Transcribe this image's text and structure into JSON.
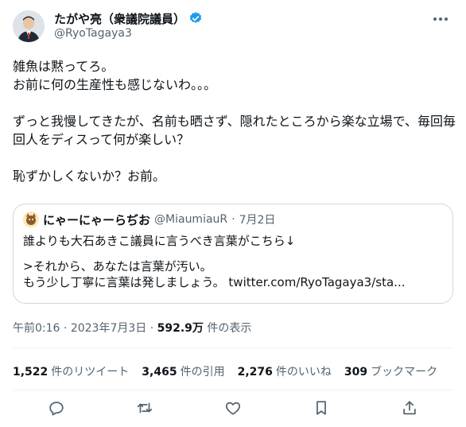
{
  "author": {
    "display_name": "たがや亮（衆議院議員）",
    "handle": "@RyoTagaya3"
  },
  "tweet": {
    "lines": [
      "雑魚は黙ってろ。",
      "お前に何の生産性も感じないわ。。。",
      "ずっと我慢してきたが、名前も晒さず、隠れたところから楽な立場で、毎回毎回人をディスって何が楽しい？",
      "恥ずかしくないか？お前。"
    ]
  },
  "quote": {
    "display_name": "にゃーにゃーらぢお",
    "handle": "@MiaumiauR",
    "separator": "·",
    "date": "7月2日",
    "line1": "誰よりも大石あきこ議員に言うべき言葉がこちら↓",
    "line2": ">それから、あなたは言葉が汚い。",
    "line3": "もう少し丁寧に言葉は発しましょう。 twitter.com/RyoTagaya3/sta..."
  },
  "meta": {
    "time": "午前0:16",
    "separator": " · ",
    "date": "2023年7月3日",
    "views": "592.9万",
    "views_label": "件の表示"
  },
  "stats": {
    "retweets": "1,522",
    "retweets_label": "件のリツイート",
    "quotes": "3,465",
    "quotes_label": "件の引用",
    "likes": "2,276",
    "likes_label": "件のいいね",
    "bookmarks": "309",
    "bookmarks_label": "ブックマーク"
  },
  "colors": {
    "text": "#0f1419",
    "secondary": "#536471",
    "border": "#cfd9de",
    "verified": "#1d9bf0"
  },
  "icons": [
    "verified-badge-icon",
    "more-icon",
    "reply-icon",
    "retweet-icon",
    "like-icon",
    "bookmark-icon",
    "share-icon"
  ]
}
